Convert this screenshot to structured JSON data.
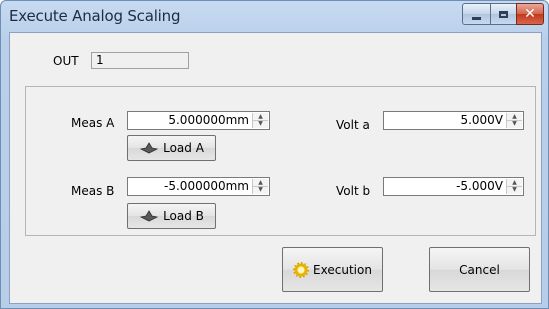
{
  "window": {
    "title": "Execute Analog Scaling",
    "minimize_symbol": "",
    "maximize_symbol": "",
    "close_symbol": "✕"
  },
  "out": {
    "label": "OUT",
    "value": "1"
  },
  "fields": {
    "meas_a": {
      "label": "Meas A",
      "value": "5.000000mm"
    },
    "meas_b": {
      "label": "Meas B",
      "value": "-5.000000mm"
    },
    "volt_a": {
      "label": "Volt a",
      "value": "5.000V"
    },
    "volt_b": {
      "label": "Volt b",
      "value": "-5.000V"
    }
  },
  "buttons": {
    "load_a": "Load A",
    "load_b": "Load B",
    "execution": "Execution",
    "cancel": "Cancel"
  },
  "icons": {
    "load": "load-icon",
    "execution": "gear-icon",
    "spin_up": "▲",
    "spin_down": "▼"
  }
}
